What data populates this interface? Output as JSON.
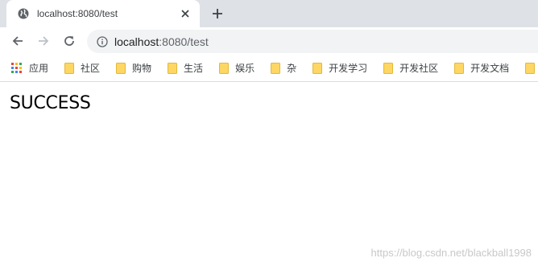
{
  "tab": {
    "title": "localhost:8080/test",
    "favicon": "globe-icon",
    "close_icon": "close-icon"
  },
  "new_tab_icon": "plus-icon",
  "toolbar": {
    "back_icon": "back-arrow-icon",
    "forward_icon": "forward-arrow-icon",
    "reload_icon": "reload-icon",
    "info_icon": "info-icon",
    "url_host": "localhost",
    "url_path": ":8080/test"
  },
  "bookmarks": {
    "apps_label": "应用",
    "items": [
      {
        "label": "社区"
      },
      {
        "label": "购物"
      },
      {
        "label": "生活"
      },
      {
        "label": "娱乐"
      },
      {
        "label": "杂"
      },
      {
        "label": "开发学习"
      },
      {
        "label": "开发社区"
      },
      {
        "label": "开发文档"
      }
    ]
  },
  "page": {
    "message": "SUCCESS",
    "watermark": "https://blog.csdn.net/blackball1998"
  },
  "colors": {
    "tabstrip_bg": "#dee1e6",
    "omnibox_bg": "#f1f3f4",
    "folder_yellow": "#fdd663",
    "folder_edge": "#e2b93b"
  }
}
